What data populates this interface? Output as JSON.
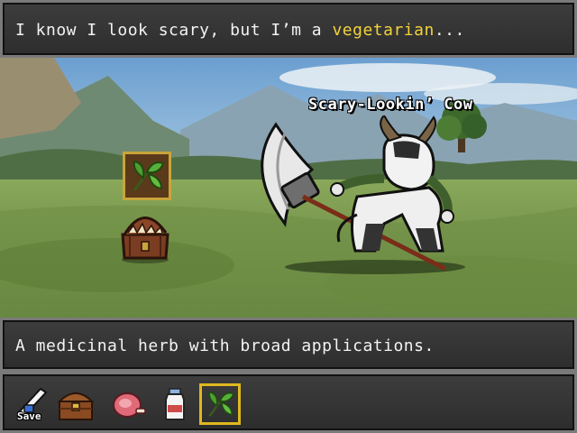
{
  "dialog": {
    "before": "I know I look scary, but I’m a ",
    "highlight": "vegetarian",
    "after": "..."
  },
  "enemy": {
    "name": "Scary-Lookin’ Cow"
  },
  "description": {
    "text": "A medicinal herb with broad applications."
  },
  "scene_items": [
    {
      "icon": "herb-icon",
      "selected": true
    },
    {
      "icon": "mimic-chest-icon",
      "selected": false
    }
  ],
  "toolbar": {
    "save_label": "Save",
    "items": [
      {
        "icon": "save-quill-icon"
      },
      {
        "icon": "treasure-chest-icon"
      },
      {
        "icon": "meat-icon"
      },
      {
        "icon": "milk-bottle-icon"
      },
      {
        "icon": "herb-icon",
        "selected": true
      }
    ]
  },
  "colors": {
    "highlight": "#f2d23a",
    "selection_border": "#e0b81e",
    "panel_bg": "#363636",
    "panel_border": "#7a7a7a"
  }
}
